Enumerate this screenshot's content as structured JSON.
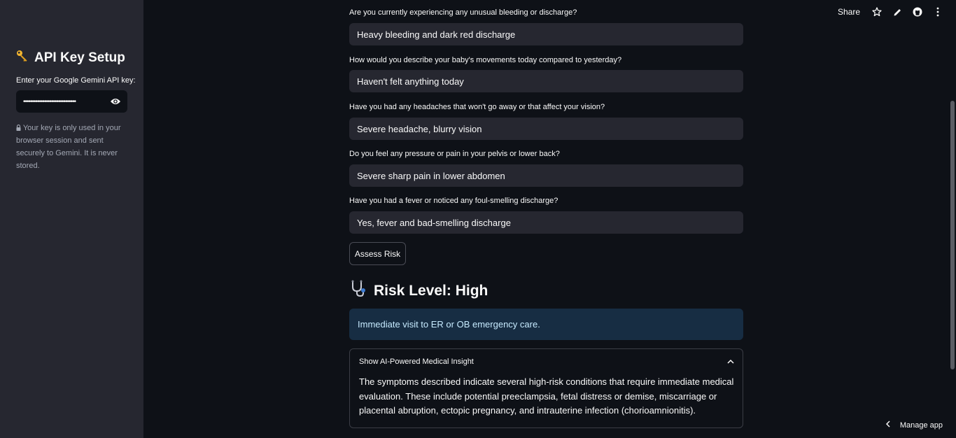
{
  "sidebar": {
    "title": "API Key Setup",
    "title_icon": "key-icon",
    "api_key_label": "Enter your Google Gemini API key:",
    "api_key_value": "••••••••••••••••••••••••••••••",
    "note": "Your key is only used in your browser session and sent securely to Gemini. It is never stored."
  },
  "header": {
    "share_label": "Share"
  },
  "questions": [
    {
      "label": "Are you currently experiencing any unusual bleeding or discharge?",
      "answer": "Heavy bleeding and dark red discharge"
    },
    {
      "label": "How would you describe your baby's movements today compared to yesterday?",
      "answer": "Haven't felt anything today"
    },
    {
      "label": "Have you had any headaches that won't go away or that affect your vision?",
      "answer": "Severe headache, blurry vision"
    },
    {
      "label": "Do you feel any pressure or pain in your pelvis or lower back?",
      "answer": "Severe sharp pain in lower abdomen"
    },
    {
      "label": "Have you had a fever or noticed any foul-smelling discharge?",
      "answer": "Yes, fever and bad-smelling discharge"
    }
  ],
  "assess_button": "Assess Risk",
  "result": {
    "title": "Risk Level: High",
    "icon": "stethoscope-icon",
    "recommendation": "Immediate visit to ER or OB emergency care."
  },
  "insight": {
    "header": "Show AI-Powered Medical Insight",
    "body": "The symptoms described indicate several high-risk conditions that require immediate medical evaluation. These include potential preeclampsia, fetal distress or demise, miscarriage or placental abruption, ectopic pregnancy, and intrauterine infection (chorioamnionitis)."
  },
  "footer": {
    "manage_app": "Manage app"
  }
}
